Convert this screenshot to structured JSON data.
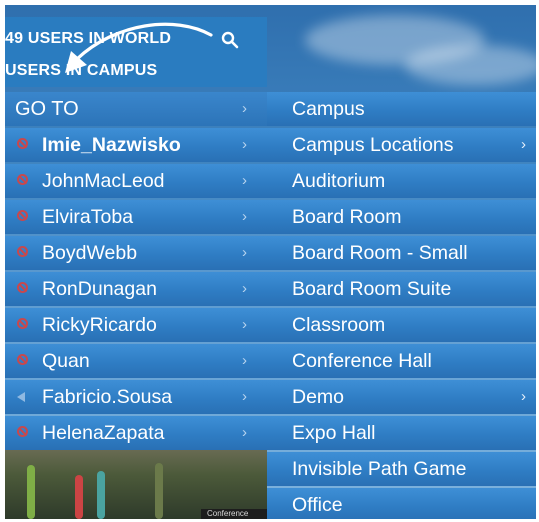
{
  "header": {
    "users_in_world": "49 USERS IN WORLD",
    "users_in_campus": "USERS IN CAMPUS"
  },
  "goto_menu": {
    "label": "GO TO",
    "users": [
      {
        "name": "Imie_Nazwisko",
        "bold": true,
        "status": "unavailable-icon"
      },
      {
        "name": "JohnMacLeod",
        "bold": false,
        "status": "unavailable-icon"
      },
      {
        "name": "ElviraToba",
        "bold": false,
        "status": "unavailable-icon"
      },
      {
        "name": "BoydWebb",
        "bold": false,
        "status": "unavailable-icon"
      },
      {
        "name": "RonDunagan",
        "bold": false,
        "status": "unavailable-icon"
      },
      {
        "name": "RickyRicardo",
        "bold": false,
        "status": "unavailable-icon"
      },
      {
        "name": "Quan",
        "bold": false,
        "status": "unavailable-icon"
      },
      {
        "name": "Fabricio.Sousa",
        "bold": false,
        "status": "speaker-icon"
      },
      {
        "name": "HelenaZapata",
        "bold": false,
        "status": "unavailable-icon"
      }
    ]
  },
  "locations_menu": {
    "items": [
      {
        "label": "Campus",
        "submenu": false
      },
      {
        "label": "Campus Locations",
        "submenu": true
      },
      {
        "label": "Auditorium",
        "submenu": false
      },
      {
        "label": "Board Room",
        "submenu": false
      },
      {
        "label": "Board Room - Small",
        "submenu": false
      },
      {
        "label": "Board Room Suite",
        "submenu": false
      },
      {
        "label": "Classroom",
        "submenu": false
      },
      {
        "label": "Conference Hall",
        "submenu": false
      },
      {
        "label": "Demo",
        "submenu": true
      },
      {
        "label": "Expo Hall",
        "submenu": false
      },
      {
        "label": "Invisible Path Game",
        "submenu": false
      },
      {
        "label": "Office",
        "submenu": false
      }
    ]
  },
  "scene": {
    "label": "Conference"
  },
  "colors": {
    "menu_blue": "#2f7dc4",
    "header_blue": "#2a7cc0",
    "status_red": "#c8484d"
  }
}
